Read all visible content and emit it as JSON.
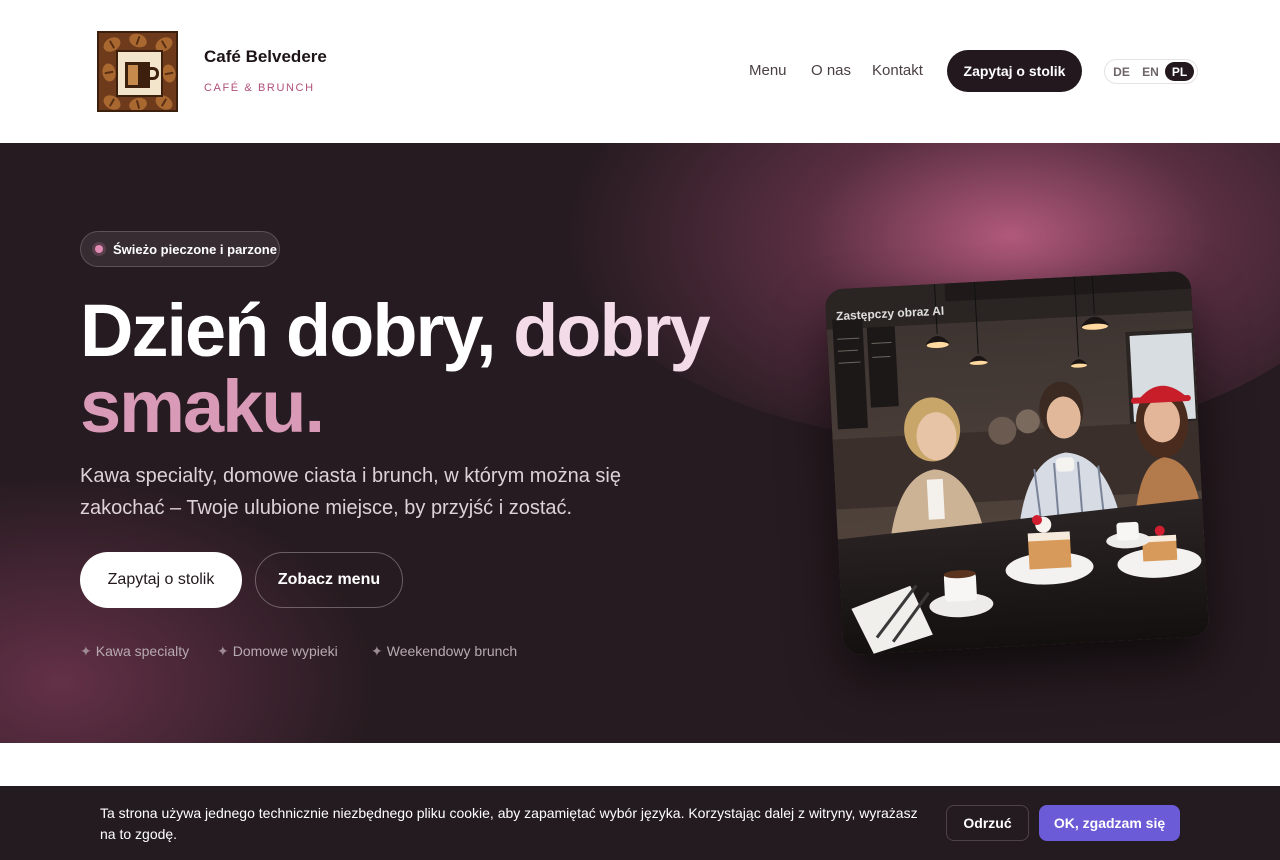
{
  "header": {
    "brand_name": "Café Belvedere",
    "brand_tagline": "CAFÉ & BRUNCH",
    "nav": [
      {
        "label": "Menu"
      },
      {
        "label": "O nas"
      },
      {
        "label": "Kontakt"
      }
    ],
    "cta_label": "Zapytaj o stolik",
    "languages": [
      {
        "code": "DE",
        "active": false
      },
      {
        "code": "EN",
        "active": false
      },
      {
        "code": "PL",
        "active": true
      }
    ]
  },
  "hero": {
    "badge": "Świeżo pieczone i parzone",
    "title_part1": "Dzień dobry, ",
    "title_part2": "dobry",
    "title_part3": "smaku.",
    "lead": "Kawa specialty, domowe ciasta i brunch, w którym można się zakochać – Twoje ulubione miejsce, by przyjść i zostać.",
    "primary_button": "Zapytaj o stolik",
    "secondary_button": "Zobacz menu",
    "features": [
      {
        "icon": "sparkle-icon",
        "label": "Kawa specialty"
      },
      {
        "icon": "sparkle-icon",
        "label": "Domowe wypieki"
      },
      {
        "icon": "sparkle-icon",
        "label": "Weekendowy brunch"
      }
    ],
    "image_caption": "Zastępczy obraz AI"
  },
  "cookie": {
    "text": "Ta strona używa jednego technicznie niezbędnego pliku cookie, aby zapamiętać wybór języka. Korzystając dalej z witryny, wyrażasz na to zgodę.",
    "reject_label": "Odrzuć",
    "accept_label": "OK, zgadzam się"
  },
  "colors": {
    "hero_bg": "#261b20",
    "accent_pink": "#d99ab7",
    "dark_button": "#22181d",
    "accept_button": "#6b5bd6"
  }
}
